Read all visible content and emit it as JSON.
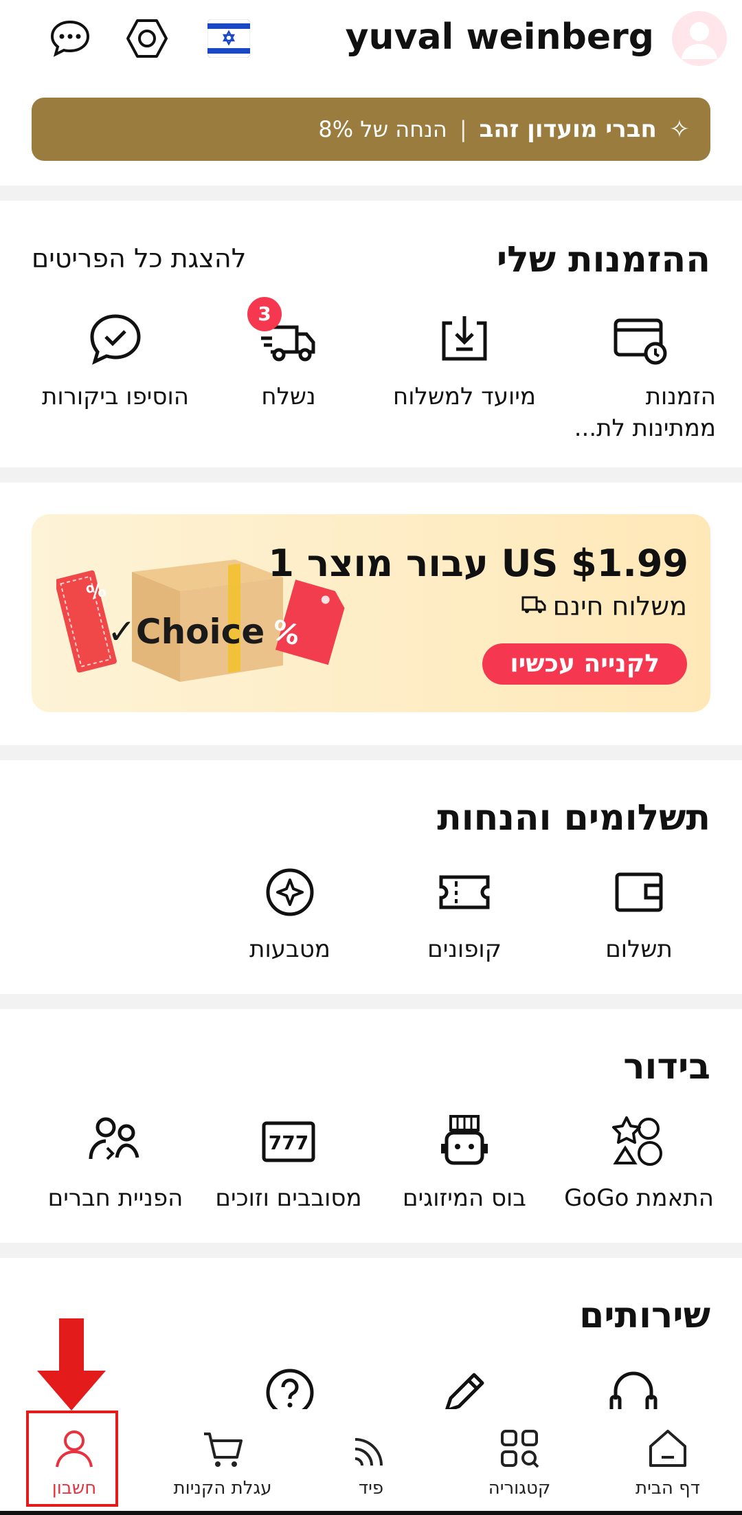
{
  "header": {
    "username": "yuval weinberg",
    "icons": [
      "avatar-icon",
      "israel-flag-icon",
      "settings-icon",
      "messages-icon"
    ]
  },
  "gold_banner": {
    "title": "חברי מועדון זהב",
    "separator": "|",
    "discount": "הנחה של 8%"
  },
  "orders": {
    "title": "ההזמנות שלי",
    "view_all": "להצגת כל הפריטים",
    "items": [
      {
        "label": "הזמנות ממתינות לת...",
        "icon": "pending-payment-icon"
      },
      {
        "label": "מיועד למשלוח",
        "icon": "to-ship-icon"
      },
      {
        "label": "נשלח",
        "icon": "shipped-truck-icon",
        "badge": "3"
      },
      {
        "label": "הוסיפו ביקורות",
        "icon": "review-icon"
      }
    ]
  },
  "promo": {
    "price_text": "US $1.99 עבור מוצר 1",
    "shipping_text": "משלוח חינם",
    "cta": "לקנייה עכשיו",
    "box_text": "✓Choice",
    "tag_text": "%",
    "colors": {
      "accent": "#f5384f",
      "background": "#fdf3d6"
    }
  },
  "payments": {
    "title": "תשלומים והנחות",
    "items": [
      {
        "label": "תשלום",
        "icon": "wallet-icon"
      },
      {
        "label": "קופונים",
        "icon": "coupon-icon"
      },
      {
        "label": "מטבעות",
        "icon": "coins-icon"
      }
    ]
  },
  "entertainment": {
    "title": "בידור",
    "items": [
      {
        "label": "התאמת GoGo",
        "icon": "gogo-match-icon"
      },
      {
        "label": "בוס המיזוגים",
        "icon": "merge-boss-icon"
      },
      {
        "label": "מסובבים וזוכים",
        "icon": "slot-777-icon"
      },
      {
        "label": "הפניית חברים",
        "icon": "refer-friends-icon"
      }
    ]
  },
  "services": {
    "title": "שירותים",
    "icons": [
      "headset-icon",
      "pencil-icon",
      "help-icon"
    ]
  },
  "bottom_nav": {
    "items": [
      {
        "label": "דף הבית",
        "icon": "home-icon"
      },
      {
        "label": "קטגוריה",
        "icon": "category-icon"
      },
      {
        "label": "פיד",
        "icon": "feed-icon"
      },
      {
        "label": "עגלת הקניות",
        "icon": "cart-icon"
      },
      {
        "label": "חשבון",
        "icon": "account-icon",
        "active": true
      }
    ],
    "active_color": "#e9323f"
  },
  "annotation": {
    "color": "#e31b1b"
  }
}
